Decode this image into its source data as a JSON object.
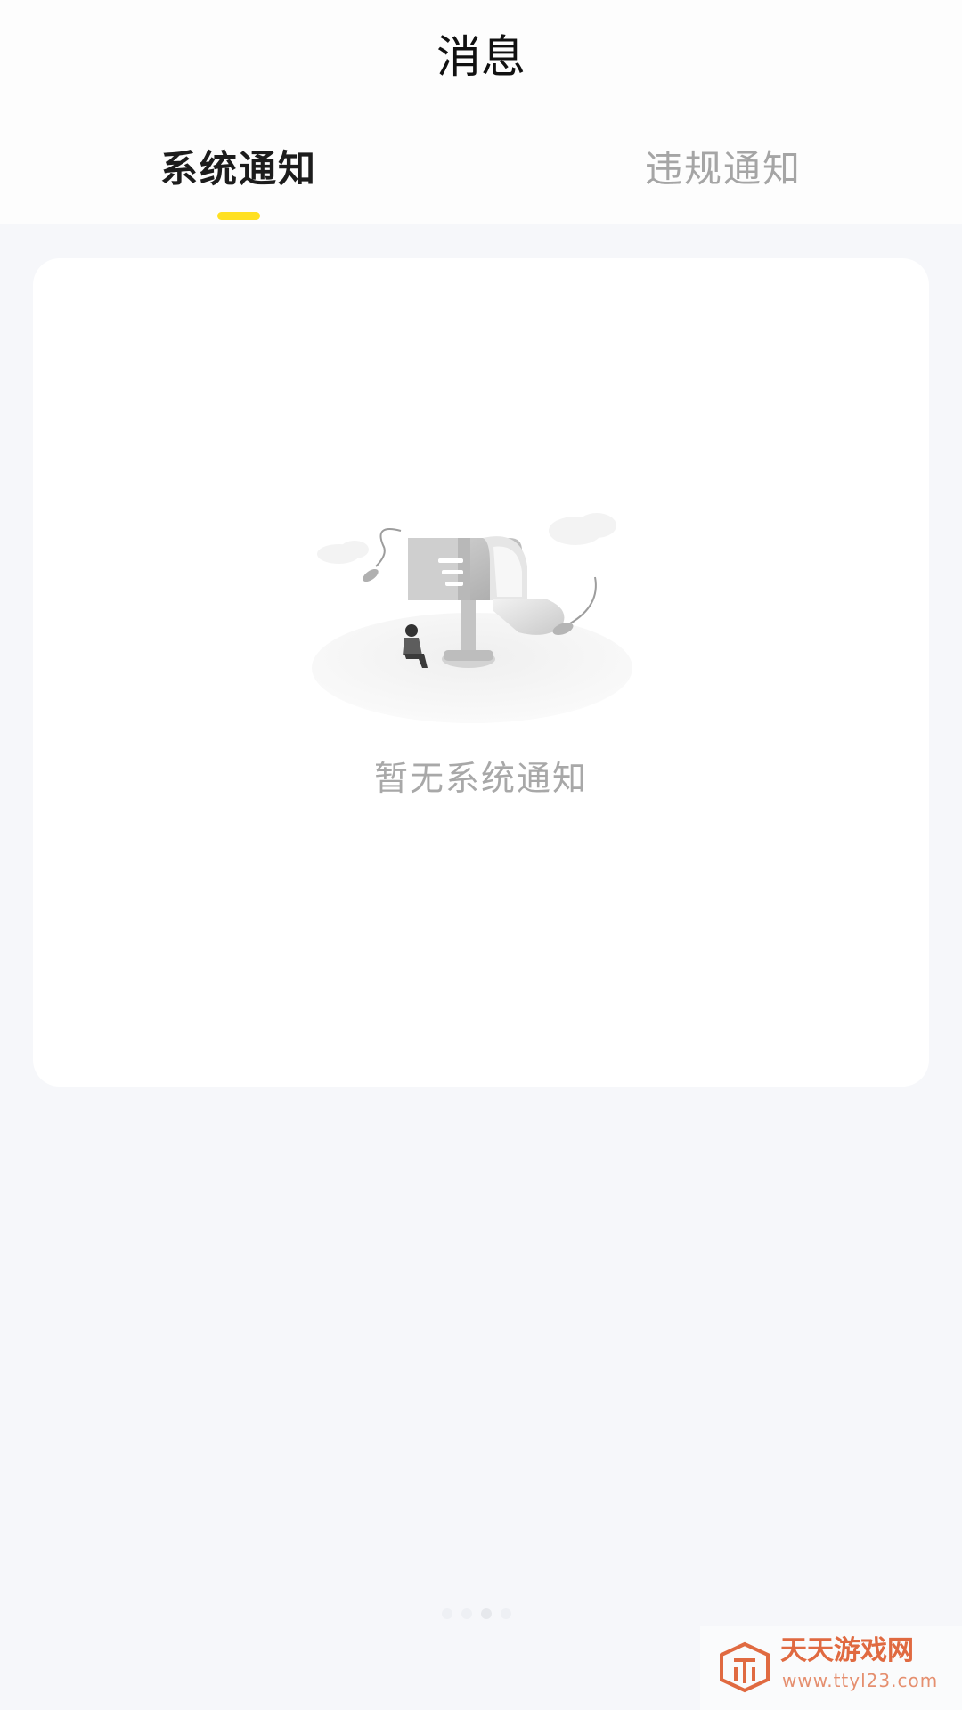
{
  "header": {
    "title": "消息"
  },
  "tabs": [
    {
      "label": "系统通知",
      "active": true
    },
    {
      "label": "违规通知",
      "active": false
    }
  ],
  "accent_color": "#ffe021",
  "empty_state": {
    "icon": "empty-mailbox-illustration",
    "message": "暂无系统通知"
  },
  "watermark": {
    "text": "天天游戏网",
    "url": "www.ttyl23.com"
  }
}
